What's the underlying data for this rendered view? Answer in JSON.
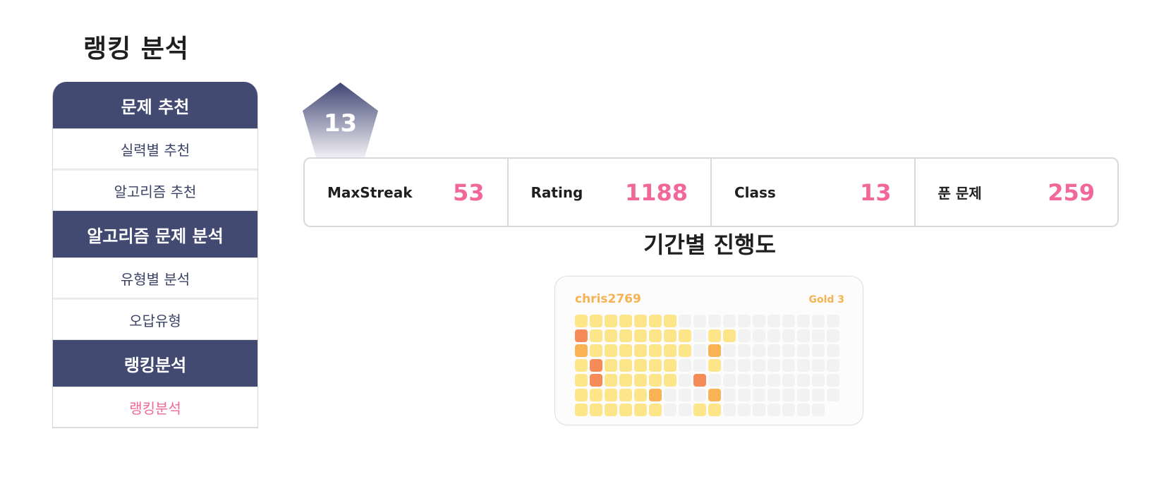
{
  "page": {
    "title": "랭킹 분석"
  },
  "sidebar": {
    "sections": [
      {
        "header": "문제 추천",
        "items": [
          {
            "label": "실력별 추천"
          },
          {
            "label": "알고리즘 추천"
          }
        ]
      },
      {
        "header": "알고리즘 문제 분석",
        "items": [
          {
            "label": "유형별 분석"
          },
          {
            "label": "오답유형"
          }
        ]
      },
      {
        "header": "랭킹분석",
        "items": [
          {
            "label": "랭킹분석",
            "active": true
          }
        ]
      }
    ]
  },
  "badge": {
    "value": "13"
  },
  "stats": [
    {
      "label": "MaxStreak",
      "value": "53"
    },
    {
      "label": "Rating",
      "value": "1188"
    },
    {
      "label": "Class",
      "value": "13"
    },
    {
      "label": "푼 문제",
      "value": "259"
    }
  ],
  "progress": {
    "title": "기간별 진행도",
    "user": "chris2769",
    "tier": "Gold 3",
    "colors": {
      "0": "#f2f2f2",
      "1": "#fde68a",
      "2": "#f9b354",
      "3": "#f58b58"
    },
    "grid": [
      [
        1,
        3,
        2,
        1,
        1,
        1,
        1
      ],
      [
        1,
        1,
        1,
        3,
        3,
        1,
        1
      ],
      [
        1,
        1,
        1,
        1,
        1,
        1,
        1
      ],
      [
        1,
        1,
        1,
        1,
        1,
        1,
        1
      ],
      [
        1,
        1,
        1,
        1,
        1,
        1,
        1
      ],
      [
        1,
        1,
        1,
        1,
        1,
        2,
        1
      ],
      [
        1,
        1,
        1,
        1,
        1,
        0,
        0
      ],
      [
        0,
        1,
        1,
        0,
        0,
        0,
        0
      ],
      [
        0,
        0,
        0,
        0,
        3,
        0,
        1
      ],
      [
        0,
        1,
        2,
        1,
        0,
        2,
        1
      ],
      [
        0,
        1,
        0,
        0,
        0,
        0,
        0
      ],
      [
        0,
        0,
        0,
        0,
        0,
        0,
        0
      ],
      [
        0,
        0,
        0,
        0,
        0,
        0,
        0
      ],
      [
        0,
        0,
        0,
        0,
        0,
        0,
        0
      ],
      [
        0,
        0,
        0,
        0,
        0,
        0,
        0
      ],
      [
        0,
        0,
        0,
        0,
        0,
        0,
        0
      ],
      [
        0,
        0,
        0,
        0,
        0,
        0,
        0
      ],
      [
        0,
        0,
        0,
        0,
        0,
        0,
        -1
      ]
    ]
  }
}
